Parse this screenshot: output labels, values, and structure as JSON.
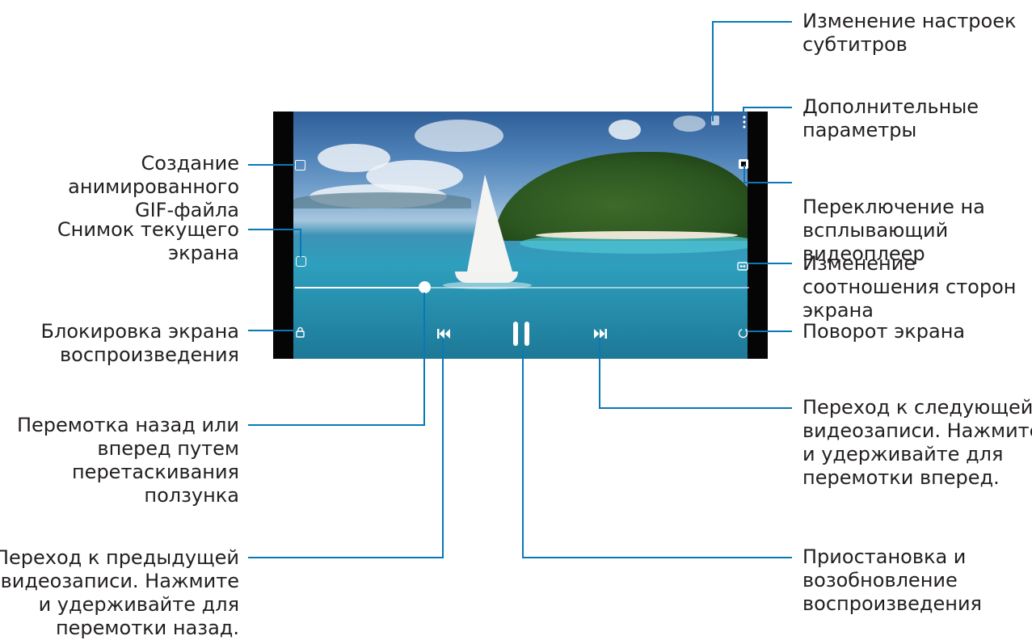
{
  "colors": {
    "leader_line": "#0a78b7",
    "text": "#231f20",
    "frame": "#050505"
  },
  "player": {
    "seek_progress": 0.28,
    "icons": {
      "gif": "gif-create-icon",
      "capture": "screenshot-capture-icon",
      "lock": "lock-icon",
      "subtitles": "subtitles-icon",
      "more": "more-options-icon",
      "popup": "popup-player-icon",
      "ratio": "aspect-ratio-icon",
      "rotate": "rotate-screen-icon",
      "previous": "skip-previous-icon",
      "pause": "pause-icon",
      "next": "skip-next-icon"
    }
  },
  "callouts": {
    "subtitles": [
      "Изменение настроек",
      "субтитров"
    ],
    "more_options": [
      "Дополнительные",
      "параметры"
    ],
    "popup_player": [
      "Переключение на",
      "всплывающий",
      "видеоплеер"
    ],
    "aspect_ratio": [
      "Изменение",
      "соотношения сторон",
      "экрана"
    ],
    "rotate": [
      "Поворот экрана"
    ],
    "next_video": [
      "Переход к следующей",
      "видеозаписи. Нажмите",
      "и удерживайте для",
      "перемотки вперед."
    ],
    "pause_resume": [
      "Приостановка и",
      "возобновление",
      "воспроизведения"
    ],
    "gif": [
      "Создание",
      "анимированного",
      "GIF-файла"
    ],
    "capture": [
      "Снимок текущего",
      "экрана"
    ],
    "lock": [
      "Блокировка экрана",
      "воспроизведения"
    ],
    "seek": [
      "Перемотка назад или",
      "вперед путем",
      "перетаскивания",
      "ползунка"
    ],
    "previous_video": [
      "Переход к предыдущей",
      "видеозаписи. Нажмите",
      "и удерживайте для",
      "перемотки назад."
    ]
  }
}
